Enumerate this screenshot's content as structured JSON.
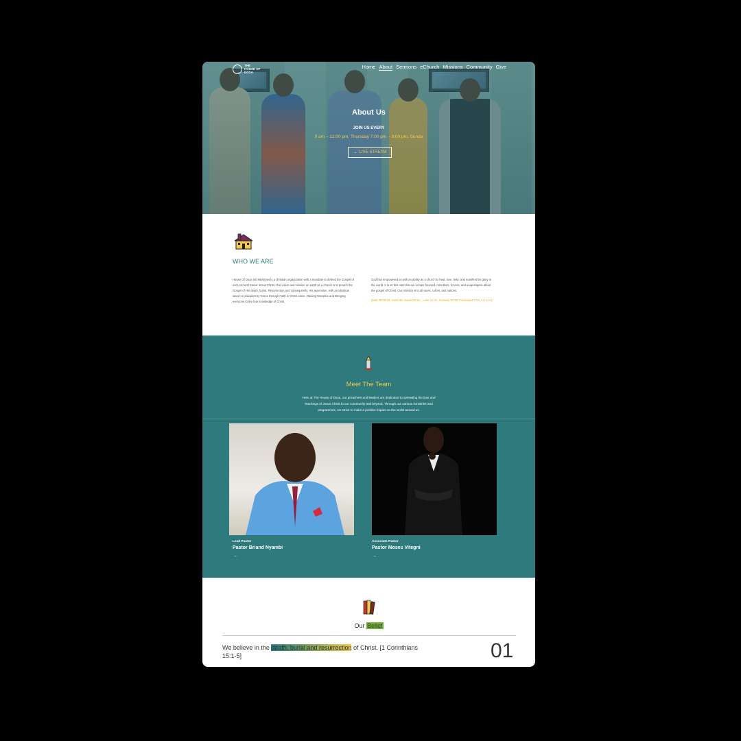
{
  "header": {
    "logo_text": "THE HOUSE OF DOXA",
    "nav": [
      {
        "label": "Home"
      },
      {
        "label": "About"
      },
      {
        "label": "Sermons"
      },
      {
        "label": "eChurch"
      },
      {
        "label": "Missions"
      },
      {
        "label": "Community"
      },
      {
        "label": "Give"
      }
    ],
    "active_nav": "About"
  },
  "hero": {
    "title": "About Us",
    "join_label": "JOIN US EVERY",
    "times": "0 am – 12:00 pm, Thursday 7:00 pm – 8:00 pm, Sunda",
    "live_button": "LIVE STREAM"
  },
  "who": {
    "title": "WHO WE ARE",
    "left_text": "House Of Doxa Intl Ministries is a christian organization with a mandate to defend the Gospel of our Lord and Savior Jesus Christ. Our vision and mission on earth as a church is to preach the Gospel of His death, burial, Resurrection and consequently, His ascension, with an absolute stand on salvation by Grace through Faith in Christ alone. Raising Disciples and Bringing everyone to the true knowledge of Christ",
    "right_text": "God has empowered us with an ability as a church to heal, love, help, and manifest his glory in the world. It is on this note that we remain focused, relentless, fervent, and unapologetic about the gospel of Christ. Our ministry is to all races, colors, and nations.",
    "scripture": "(Matt 28:18-20, Acts1:29, Isaiah 62:10, , Luke 24:47, Romans 10:18, Colossians 1:23, Act 4:12)"
  },
  "team": {
    "title": "Meet The Team",
    "description": "Here at The House of Doxa, our preachers and leaders are dedicated to spreading the love and teachings of Jesus Christ to our community and beyond. Through our various ministries and programmes, we strive to make a positive impact on the world around us.",
    "members": [
      {
        "role": "Lead Pastor",
        "name": "Pastor Briand Nyambi"
      },
      {
        "role": "Associate Pastor",
        "name": "Pastor Moses Vitegni"
      }
    ],
    "arrow": "→"
  },
  "belief": {
    "title_prefix": "Our ",
    "title_highlight": "Belief",
    "text_before": "We believe in the ",
    "text_highlight": "death, burial and resurrection",
    "text_after": " of Christ. [1 Corinthians 15:1-5]",
    "number": "01"
  },
  "colors": {
    "teal": "#2e7a7d",
    "gold": "#f2c94c",
    "background": "#000000"
  }
}
